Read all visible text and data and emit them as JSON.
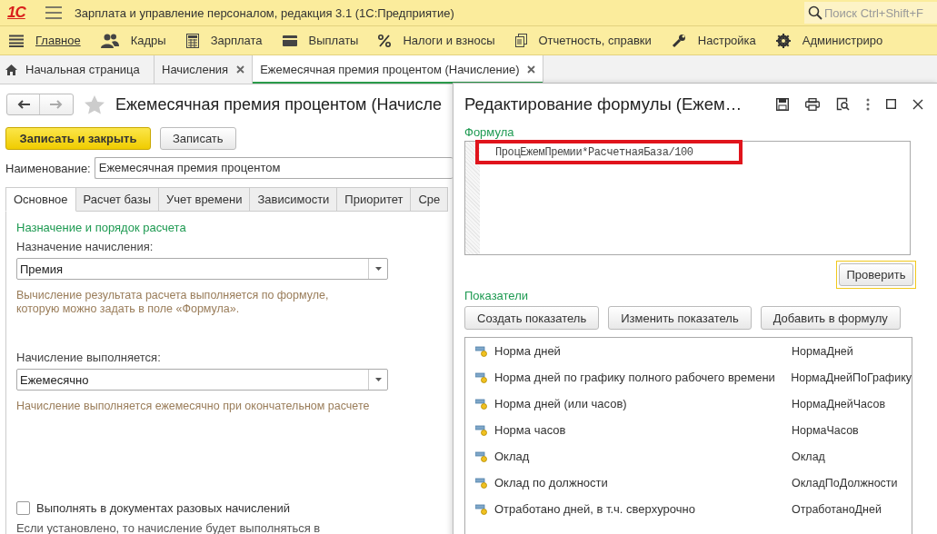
{
  "window": {
    "logo": "1С",
    "title": "Зарплата и управление персоналом, редакция 3.1  (1С:Предприятие)"
  },
  "search": {
    "placeholder": "Поиск Ctrl+Shift+F"
  },
  "sections": [
    {
      "label": "Главное",
      "kind": "menu",
      "selected": true
    },
    {
      "label": "Кадры",
      "kind": "people",
      "selected": false
    },
    {
      "label": "Зарплата",
      "kind": "calc",
      "selected": false
    },
    {
      "label": "Выплаты",
      "kind": "card",
      "selected": false
    },
    {
      "label": "Налоги и взносы",
      "kind": "percent",
      "selected": false
    },
    {
      "label": "Отчетность, справки",
      "kind": "docs",
      "selected": false
    },
    {
      "label": "Настройка",
      "kind": "wrench",
      "selected": false
    },
    {
      "label": "Администриро",
      "kind": "gear",
      "selected": false
    }
  ],
  "open_tabs": [
    {
      "label": "Начальная страница",
      "kind": "home",
      "closable": false,
      "selected": false
    },
    {
      "label": "Начисления",
      "kind": "doc",
      "closable": true,
      "selected": false
    },
    {
      "label": "Ежемесячная премия процентом (Начисление)",
      "kind": "doc",
      "closable": true,
      "selected": true
    }
  ],
  "form": {
    "title": "Ежемесячная премия процентом (Начисле",
    "buttons": [
      {
        "label": "Записать и закрыть",
        "kind": "primary"
      },
      {
        "label": "Записать",
        "kind": "default"
      }
    ],
    "name_label": "Наименование:",
    "name_value": "Ежемесячная премия процентом",
    "tabs": [
      {
        "label": "Основное",
        "selected": true
      },
      {
        "label": "Расчет базы",
        "selected": false
      },
      {
        "label": "Учет времени",
        "selected": false
      },
      {
        "label": "Зависимости",
        "selected": false
      },
      {
        "label": "Приоритет",
        "selected": false
      },
      {
        "label": "Сре",
        "selected": false
      }
    ],
    "section_title": "Назначение и порядок расчета",
    "purpose_label": "Назначение начисления:",
    "purpose_value": "Премия",
    "purpose_hint": "Вычисление результата расчета выполняется по формуле,\nкоторую можно задать в поле «Формула».",
    "mode_label": "Начисление выполняется:",
    "mode_value": "Ежемесячно",
    "mode_hint": "Начисление выполняется ежемесячно при окончательном расчете",
    "checkbox": {
      "label": "Выполнять в документах разовых начислений",
      "checked": false
    },
    "checkbox_hint": "Если установлено, то начисление будет выполняться в"
  },
  "dialog": {
    "title": "Редактирование формулы (Ежем…",
    "formula_label": "Формула",
    "formula": "ПроцЕжемПремии*РасчетнаяБаза/100",
    "check_button": "Проверить",
    "indicators_label": "Показатели",
    "buttons": [
      "Создать показатель",
      "Изменить показатель",
      "Добавить в формулу"
    ],
    "indicators": [
      {
        "name": "Норма дней",
        "id": "НормаДней"
      },
      {
        "name": "Норма дней по графику полного рабочего времени",
        "id": "НормаДнейПоГрафику"
      },
      {
        "name": "Норма дней (или часов)",
        "id": "НормаДнейЧасов"
      },
      {
        "name": "Норма часов",
        "id": "НормаЧасов"
      },
      {
        "name": "Оклад",
        "id": "Оклад"
      },
      {
        "name": "Оклад по должности",
        "id": "ОкладПоДолжности"
      },
      {
        "name": "Отработано дней, в т.ч. сверхурочно",
        "id": "ОтработаноДней"
      }
    ]
  }
}
